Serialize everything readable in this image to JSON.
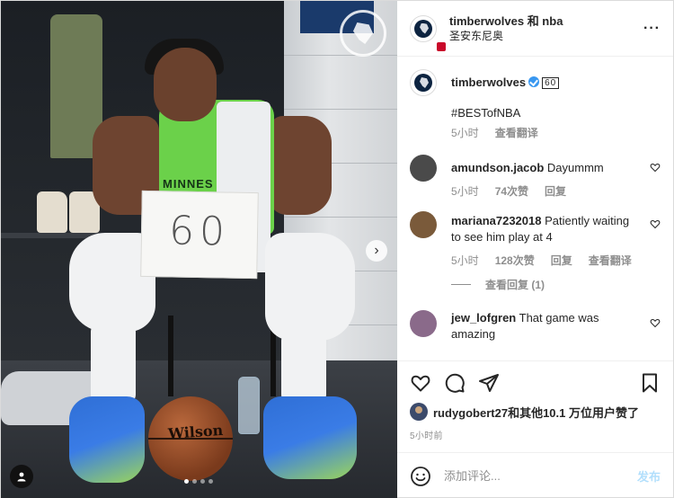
{
  "header": {
    "title": "timberwolves 和 nba",
    "location": "圣安东尼奥",
    "more_icon": "more-horizontal-icon"
  },
  "caption": {
    "username": "timberwolves",
    "badge": "60",
    "text": "#BESTofNBA",
    "time": "5小时",
    "translate": "查看翻译"
  },
  "comments": [
    {
      "username": "amundson.jacob",
      "text": "Dayummm",
      "time": "5小时",
      "likes": "74次赞",
      "reply": "回复",
      "avatar_color": "#4a4a4a"
    },
    {
      "username": "mariana7232018",
      "text": "Patiently waiting to see him play at 4",
      "time": "5小时",
      "likes": "128次赞",
      "reply": "回复",
      "translate": "查看翻译",
      "avatar_color": "#7a5a3a",
      "view_replies": "查看回复 (1)"
    },
    {
      "username": "jew_lofgren",
      "text": "That game was amazing",
      "avatar_color": "#8a6a8a"
    }
  ],
  "actions": {
    "like_icon": "heart-icon",
    "comment_icon": "comment-icon",
    "share_icon": "paper-plane-icon",
    "save_icon": "bookmark-icon"
  },
  "likes": {
    "user": "rudygobert27",
    "rest": "和其他10.1 万位用户赞了"
  },
  "post_time": "5小时前",
  "composer": {
    "placeholder": "添加评论...",
    "post_label": "发布",
    "emoji_icon": "emoji-icon"
  },
  "media": {
    "sign_text": "60",
    "jersey_text": "MINNES",
    "ball_text": "Wilson",
    "carousel_index": 1,
    "carousel_count": 4
  },
  "colors": {
    "accent": "#3897f0",
    "jersey": "#6bd14a",
    "post_disabled": "#b2dffc"
  }
}
